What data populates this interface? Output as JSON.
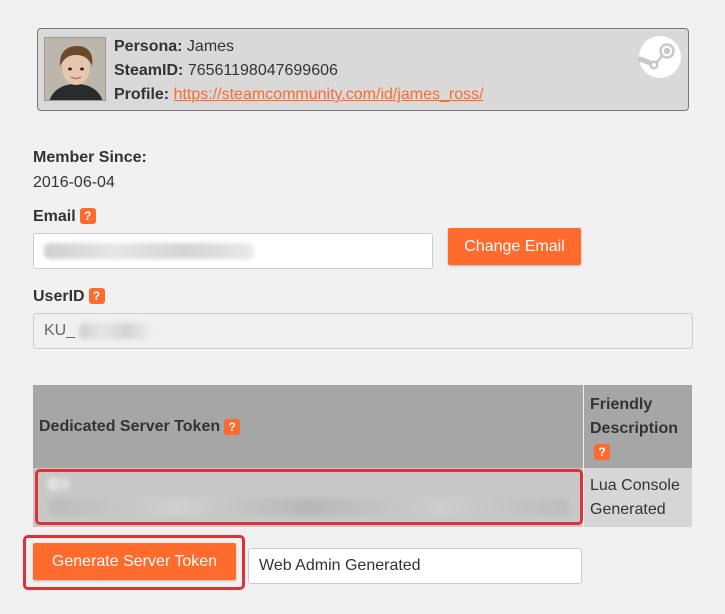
{
  "profile": {
    "persona_label": "Persona:",
    "persona_value": "James",
    "steamid_label": "SteamID:",
    "steamid_value": "76561198047699606",
    "profile_label": "Profile:",
    "profile_url": "https://steamcommunity.com/id/james_ross/",
    "logo_icon": "steam-logo-icon"
  },
  "member_since": {
    "label": "Member Since:",
    "value": "2016-06-04"
  },
  "email": {
    "label": "Email",
    "help": "?",
    "change_button": "Change Email"
  },
  "userid": {
    "label": "UserID",
    "help": "?",
    "value_prefix": "KU_"
  },
  "token_table": {
    "col_token": "Dedicated Server Token",
    "col_token_help": "?",
    "col_desc_line1": "Friendly",
    "col_desc_line2": "Description",
    "col_desc_help": "?",
    "row_desc_line1": "Lua Console",
    "row_desc_line2": "Generated"
  },
  "generate": {
    "button": "Generate Server Token",
    "description_value": "Web Admin Generated"
  },
  "colors": {
    "accent": "#ff6a2d",
    "highlight": "#e0303a"
  }
}
